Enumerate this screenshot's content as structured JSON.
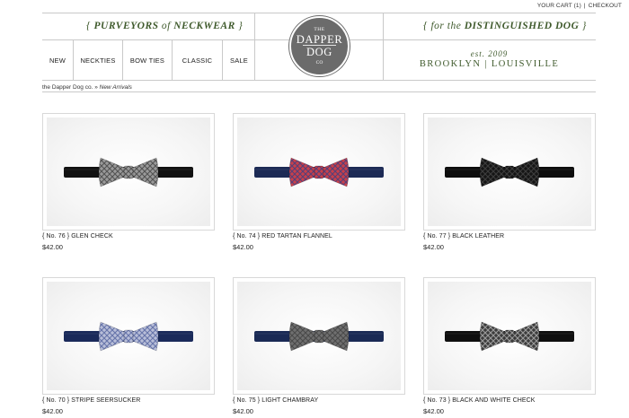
{
  "top_links": {
    "cart": "YOUR CART (1)",
    "separator": "|",
    "checkout": "CHECKOUT"
  },
  "header": {
    "left_tagline": {
      "brace_open": "{",
      "text_a": "PURVEYORS",
      "of": "of",
      "text_b": "NECKWEAR",
      "brace_close": "}"
    },
    "right_tagline": {
      "brace_open": "{",
      "for_the": "for the",
      "text": "DISTINGUISHED DOG",
      "brace_close": "}"
    },
    "logo": {
      "the": "THE",
      "line1": "DAPPER",
      "line2": "DOG",
      "co": "CO"
    },
    "established": "est. 2009",
    "locations": "BROOKLYN | LOUISVILLE"
  },
  "nav": {
    "items": [
      "NEW",
      "NECKTIES",
      "BOW TIES",
      "CLASSIC",
      "SALE"
    ]
  },
  "breadcrumb": {
    "home": "the Dapper Dog co.",
    "sep": "»",
    "current": "New Arrivals"
  },
  "products": [
    {
      "title": "{ No. 76 } GLEN CHECK",
      "price": "$42.00",
      "icon": "bow-tie-glen-check",
      "colors": {
        "bow": "#9a9a9a",
        "accent": "#3a3a3a",
        "band": "#111111"
      }
    },
    {
      "title": "{ No. 74 } RED TARTAN FLANNEL",
      "price": "$42.00",
      "icon": "bow-tie-red-tartan",
      "colors": {
        "bow": "#c8404a",
        "accent": "#2c3f8a",
        "band": "#1c2a55"
      }
    },
    {
      "title": "{ No. 77 } BLACK LEATHER",
      "price": "$42.00",
      "icon": "bow-tie-black-leather",
      "colors": {
        "bow": "#151515",
        "accent": "#4a4a4a",
        "band": "#0d0d0d"
      }
    },
    {
      "title": "{ No. 70 } STRIPE SEERSUCKER",
      "price": "$42.00",
      "icon": "bow-tie-stripe-seersucker",
      "colors": {
        "bow": "#b8bed8",
        "accent": "#4a5a9a",
        "band": "#1a2a5a"
      }
    },
    {
      "title": "{ No. 75 } LIGHT CHAMBRAY",
      "price": "$42.00",
      "icon": "bow-tie-light-chambray",
      "colors": {
        "bow": "#6f6f6f",
        "accent": "#3c3c3c",
        "band": "#1a2a55"
      }
    },
    {
      "title": "{ No. 73 } BLACK AND WHITE CHECK",
      "price": "$42.00",
      "icon": "bow-tie-black-white-check",
      "colors": {
        "bow": "#3c3c3c",
        "accent": "#bdbdbd",
        "band": "#0f0f0f"
      }
    }
  ]
}
